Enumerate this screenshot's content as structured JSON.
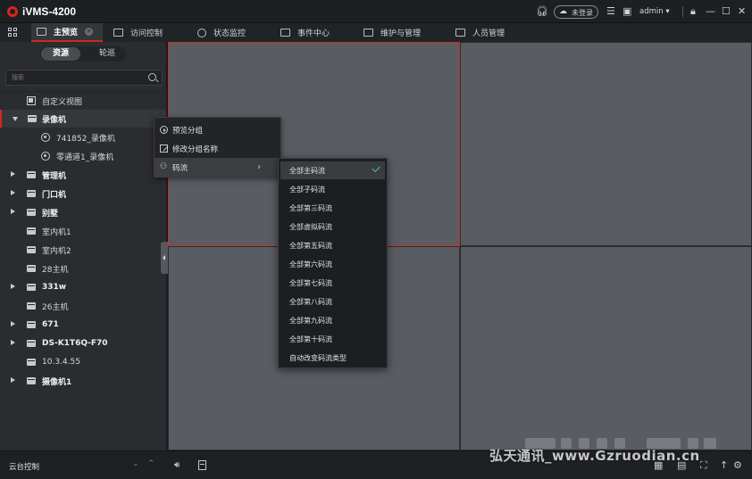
{
  "app": {
    "title": "iVMS-4200",
    "accent_color": "#d5261d",
    "login_status": "未登录",
    "user": "admin"
  },
  "tabs": [
    {
      "label": "主预览",
      "icon": "monitor-icon",
      "active": true
    },
    {
      "label": "访问控制",
      "icon": "door-icon"
    },
    {
      "label": "状态监控",
      "icon": "status-icon"
    },
    {
      "label": "事件中心",
      "icon": "event-icon"
    },
    {
      "label": "维护与管理",
      "icon": "maintenance-icon"
    },
    {
      "label": "人员管理",
      "icon": "person-icon"
    }
  ],
  "sidebar": {
    "segments": [
      "资源",
      "轮巡"
    ],
    "search_placeholder": "搜索",
    "tree": [
      {
        "label": "自定义视图",
        "icon": "custom-view-icon",
        "level": 1
      },
      {
        "label": "录像机",
        "icon": "folder-icon",
        "expanded": true,
        "selected": true,
        "level": 0
      },
      {
        "label": "741852_录像机",
        "icon": "camera-icon",
        "level": 2
      },
      {
        "label": "零通道1_录像机",
        "icon": "camera-icon",
        "level": 2
      },
      {
        "label": "管理机",
        "icon": "folder-icon",
        "level": 0
      },
      {
        "label": "门口机",
        "icon": "folder-icon",
        "level": 0
      },
      {
        "label": "别墅",
        "icon": "folder-icon",
        "level": 0
      },
      {
        "label": "室内机1",
        "icon": "folder-icon",
        "level": 1
      },
      {
        "label": "室内机2",
        "icon": "folder-icon",
        "level": 1
      },
      {
        "label": "28主机",
        "icon": "folder-icon",
        "level": 1
      },
      {
        "label": "331w",
        "icon": "folder-icon",
        "level": 0
      },
      {
        "label": "26主机",
        "icon": "folder-icon",
        "level": 1
      },
      {
        "label": "671",
        "icon": "folder-icon",
        "level": 0
      },
      {
        "label": "DS-K1T6Q-F70",
        "icon": "folder-icon",
        "level": 0
      },
      {
        "label": "10.3.4.55",
        "icon": "folder-icon",
        "level": 1
      },
      {
        "label": "摄像机1",
        "icon": "folder-icon",
        "level": 0
      }
    ]
  },
  "context_menu": {
    "items": [
      {
        "label": "预览分组",
        "icon": "play-icon"
      },
      {
        "label": "修改分组名称",
        "icon": "edit-icon"
      },
      {
        "label": "码流",
        "icon": "stream-icon",
        "has_submenu": true
      }
    ]
  },
  "stream_submenu": {
    "items": [
      {
        "label": "全部主码流",
        "checked": true
      },
      {
        "label": "全部子码流"
      },
      {
        "label": "全部第三码流"
      },
      {
        "label": "全部虚拟码流"
      },
      {
        "label": "全部第五码流"
      },
      {
        "label": "全部第六码流"
      },
      {
        "label": "全部第七码流"
      },
      {
        "label": "全部第八码流"
      },
      {
        "label": "全部第九码流"
      },
      {
        "label": "全部第十码流"
      },
      {
        "label": "自动改变码流类型"
      }
    ]
  },
  "bottom_bar": {
    "ptz_label": "云台控制"
  },
  "watermark": "弘天通讯_www.Gzruodian.cn"
}
